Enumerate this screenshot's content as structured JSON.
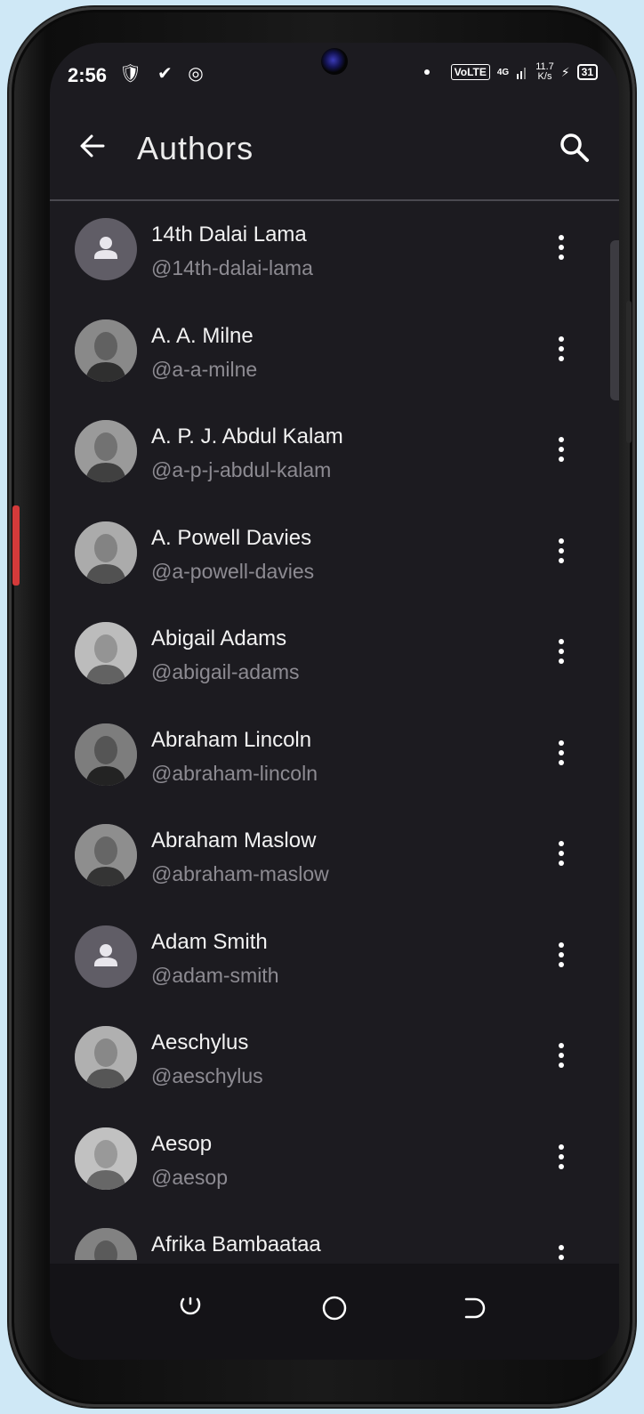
{
  "status_bar": {
    "time": "2:56",
    "left_icons": "🛡 ✔ ◎",
    "volte": "VoLTE",
    "network": "4G",
    "speed_value": "11.7",
    "speed_unit": "K/s",
    "battery": "31"
  },
  "app_bar": {
    "title": "Authors",
    "back_icon": "arrow-left-icon",
    "search_icon": "search-icon"
  },
  "authors": [
    {
      "name": "14th Dalai Lama",
      "handle": "@14th-dalai-lama",
      "avatar": "placeholder"
    },
    {
      "name": "A. A. Milne",
      "handle": "@a-a-milne",
      "avatar": "photo"
    },
    {
      "name": "A. P. J. Abdul Kalam",
      "handle": "@a-p-j-abdul-kalam",
      "avatar": "photo"
    },
    {
      "name": "A. Powell Davies",
      "handle": "@a-powell-davies",
      "avatar": "photo"
    },
    {
      "name": "Abigail Adams",
      "handle": "@abigail-adams",
      "avatar": "photo"
    },
    {
      "name": "Abraham Lincoln",
      "handle": "@abraham-lincoln",
      "avatar": "photo"
    },
    {
      "name": "Abraham Maslow",
      "handle": "@abraham-maslow",
      "avatar": "photo"
    },
    {
      "name": "Adam Smith",
      "handle": "@adam-smith",
      "avatar": "placeholder"
    },
    {
      "name": "Aeschylus",
      "handle": "@aeschylus",
      "avatar": "photo"
    },
    {
      "name": "Aesop",
      "handle": "@aesop",
      "avatar": "photo"
    },
    {
      "name": "Afrika Bambaataa",
      "handle": "",
      "avatar": "photo"
    }
  ],
  "nav_bar": {
    "recent_icon": "recent-apps-icon",
    "home_icon": "home-icon",
    "back_icon": "system-back-icon"
  },
  "colors": {
    "background": "#1c1b20",
    "text_primary": "#f2f2f2",
    "text_secondary": "#8d8b92",
    "divider": "#4a4950"
  }
}
